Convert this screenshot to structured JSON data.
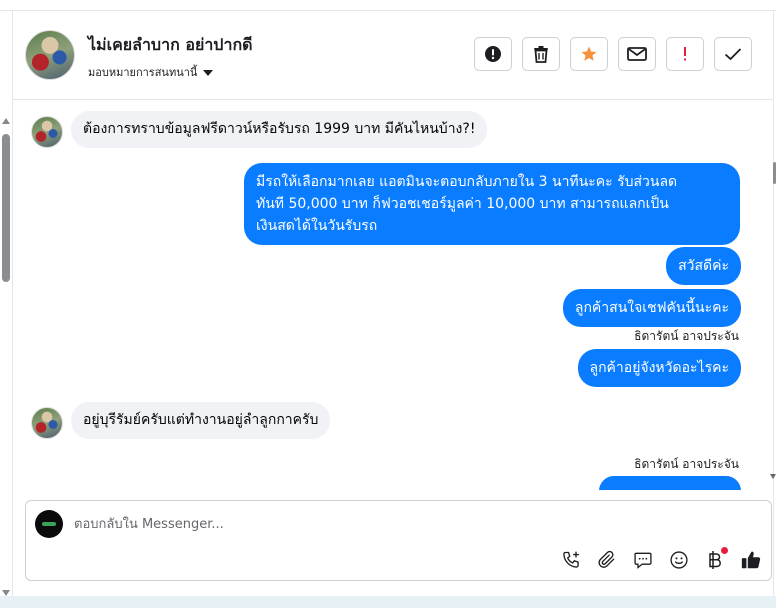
{
  "header": {
    "contact_name": "ไม่เคยลำบาก อย่าปากดี",
    "assign_label": "มอบหมายการสนทนานี้",
    "actions": [
      {
        "name": "alert-button",
        "icon": "alert-circle-icon"
      },
      {
        "name": "delete-button",
        "icon": "trash-icon"
      },
      {
        "name": "star-button",
        "icon": "star-icon",
        "color": "#f7923b"
      },
      {
        "name": "mark-unread-button",
        "icon": "envelope-icon"
      },
      {
        "name": "spam-button",
        "icon": "exclamation-icon",
        "color": "#e41e3f"
      },
      {
        "name": "done-button",
        "icon": "checkmark-icon"
      }
    ]
  },
  "messages": [
    {
      "direction": "in",
      "text": "ต้องการทราบข้อมูลฟรีดาวน์หรือรับรถ 1999 บาท มีคันไหนบ้าง?!"
    },
    {
      "direction": "out",
      "lines": [
        "มีรถให้เลือกมากเลย แอตมินจะตอบกลับภายใน 3 นาทีนะคะ รับส่วนลด",
        "ทันที 50,000 บาท ก็ฟวอชเชอร์มูลค่า 10,000 บาท สามารถแลกเป็น",
        "เงินสดได้ในวันรับรถ"
      ]
    },
    {
      "direction": "out",
      "text": "สวัสดีค่ะ"
    },
    {
      "direction": "out",
      "text": "ลูกค้าสนใจเชฟคันนี้นะคะ"
    },
    {
      "direction": "out",
      "sender": "ธิดารัตน์ อาจประจัน",
      "text": "ลูกค้าอยู่จังหวัดอะไรคะ"
    },
    {
      "direction": "in",
      "text": "อยู่บุรีรัมย์ครับแต่ทำงานอยู่ลำลูกกาครับ"
    },
    {
      "direction": "out",
      "sender": "ธิดารัตน์ อาจประจัน",
      "text": ""
    }
  ],
  "reply": {
    "placeholder": "ตอบกลับใน Messenger...",
    "tools": [
      "phone-plus-icon",
      "paperclip-icon",
      "chat-bubble-icon",
      "smiley-icon",
      "baht-icon",
      "thumbs-up-icon"
    ]
  },
  "colors": {
    "outgoing_bubble": "#0a7cff",
    "incoming_bubble": "#f0f2f5",
    "star": "#f7923b",
    "spam": "#e41e3f"
  }
}
